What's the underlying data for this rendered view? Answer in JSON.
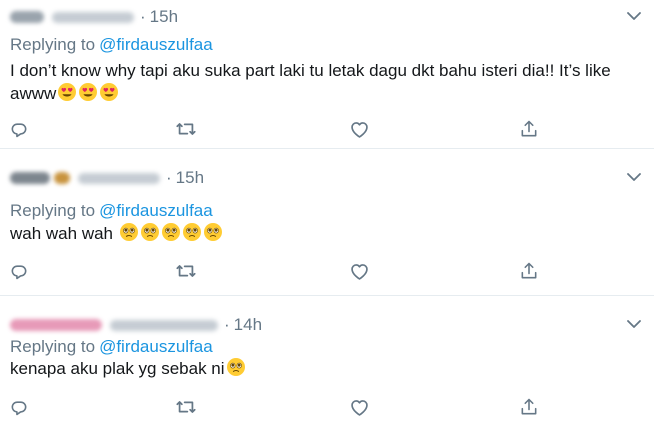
{
  "tweets": [
    {
      "time": "15h",
      "replying_label": "Replying to",
      "mention": "@firdauszulfaa",
      "text": "I don’t know why tapi aku suka part laki tu letak dagu dkt bahu isteri dia!! It’s like awww",
      "emojis": [
        "heart-eyes-face",
        "heart-eyes-face",
        "heart-eyes-face"
      ]
    },
    {
      "time": "15h",
      "replying_label": "Replying to",
      "mention": "@firdauszulfaa",
      "text": "wah wah wah",
      "emojis": [
        "pleading-face",
        "pleading-face",
        "pleading-face",
        "pleading-face",
        "pleading-face"
      ]
    },
    {
      "time": "14h",
      "replying_label": "Replying to",
      "mention": "@firdauszulfaa",
      "text": "kenapa aku plak yg sebak ni",
      "emojis": [
        "pleading-face"
      ]
    }
  ],
  "separator": "·",
  "colors": {
    "text": "#14171a",
    "muted": "#657786",
    "link": "#1b95e0",
    "divider": "#e6ecf0"
  },
  "icons": [
    "chevron-down-icon",
    "reply-icon",
    "retweet-icon",
    "like-icon",
    "share-icon"
  ]
}
